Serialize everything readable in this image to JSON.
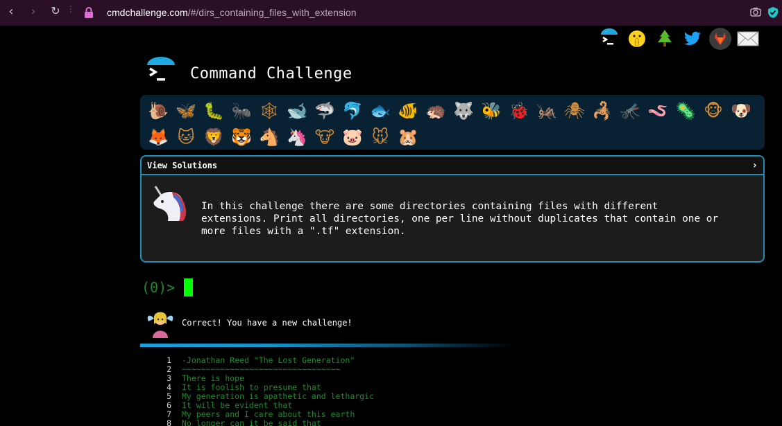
{
  "browser": {
    "url_host": "cmdchallenge.com",
    "url_path": "/#/dirs_containing_files_with_extension",
    "back_icon": "chevron-left-icon",
    "forward_icon": "chevron-right-icon",
    "reload_icon": "reload-icon"
  },
  "header": {
    "title": "Command Challenge",
    "links": [
      "terminal-icon",
      "shushing-face-icon",
      "tree-icon",
      "twitter-icon",
      "gitlab-icon",
      "mail-icon"
    ]
  },
  "animals": {
    "row1": [
      "🐌",
      "🦋",
      "🐛",
      "🐜",
      "🕸",
      "🐋",
      "🦈",
      "🐬",
      "🐟",
      "🐠",
      "🦔",
      "🐺",
      "🐝",
      "🐞",
      "🦗",
      "🕷",
      "🦂",
      "🦟",
      "🪱",
      "🦠",
      "🐵",
      "🐶"
    ],
    "row2": [
      "🦊",
      "🐱",
      "🦁",
      "🐯",
      "🐴",
      "🦄",
      "🐮",
      "🐷",
      "🐭",
      "🐹"
    ]
  },
  "challenge": {
    "header_label": "View Solutions",
    "chevron": "›",
    "text": "In this challenge there are some directories containing files with different\nextensions. Print all directories, one per line without duplicates that contain one or\nmore files with a \".tf\" extension."
  },
  "prompt": {
    "label": "(0)>"
  },
  "message": {
    "text": "Correct! You have a new challenge!",
    "progress": 0.6
  },
  "poem": [
    {
      "n": "1",
      "t": "-Jonathan Reed \"The Lost Generation\""
    },
    {
      "n": "2",
      "t": "~~~~~~~~~~~~~~~~~~~~~~~~~~~~~~~~~"
    },
    {
      "n": "3",
      "t": "There is hope"
    },
    {
      "n": "4",
      "t": "It is foolish to presume that"
    },
    {
      "n": "5",
      "t": "My generation is apathetic and lethargic"
    },
    {
      "n": "6",
      "t": "It will be evident that"
    },
    {
      "n": "7",
      "t": "My peers and I care about this earth"
    },
    {
      "n": "8",
      "t": "No longer can it be said that"
    }
  ]
}
